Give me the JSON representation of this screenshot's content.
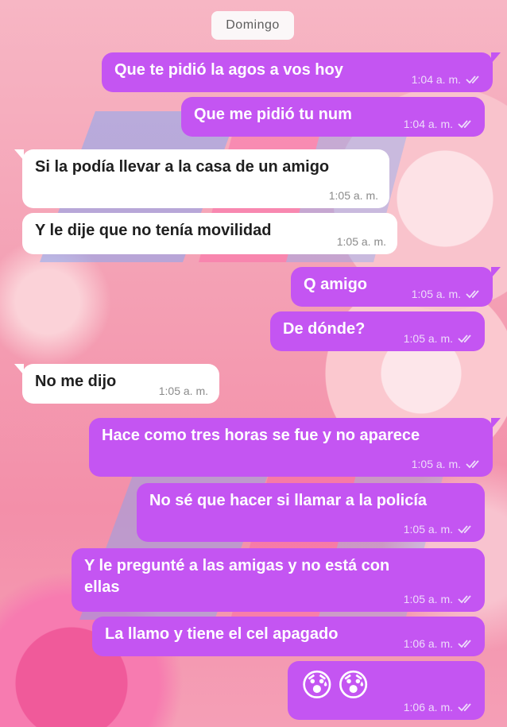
{
  "chat": {
    "day_label": "Domingo",
    "messages": [
      {
        "text": "Que te pidió la agos a vos hoy",
        "time": "1:04 a. m.",
        "direction": "out",
        "status": "read"
      },
      {
        "text": "Que me pidió tu num",
        "time": "1:04 a. m.",
        "direction": "out",
        "status": "read"
      },
      {
        "text": "Si la podía llevar a la casa de un amigo",
        "time": "1:05 a. m.",
        "direction": "in"
      },
      {
        "text": "Y le dije que no tenía movilidad",
        "time": "1:05 a. m.",
        "direction": "in"
      },
      {
        "text": "Q amigo",
        "time": "1:05 a. m.",
        "direction": "out",
        "status": "read"
      },
      {
        "text": "De dónde?",
        "time": "1:05 a. m.",
        "direction": "out",
        "status": "read"
      },
      {
        "text": "No me dijo",
        "time": "1:05 a. m.",
        "direction": "in"
      },
      {
        "text": "Hace como tres horas se fue y no aparece",
        "time": "1:05 a. m.",
        "direction": "out",
        "status": "read"
      },
      {
        "text": "No sé que hacer si llamar a la policía",
        "time": "1:05 a. m.",
        "direction": "out",
        "status": "read"
      },
      {
        "text": "Y le pregunté a las amigas y no está con ellas",
        "time": "1:05 a. m.",
        "direction": "out",
        "status": "read"
      },
      {
        "text": "La llamo y tiene el cel apagado",
        "time": "1:06 a. m.",
        "direction": "out",
        "status": "read"
      },
      {
        "text": "😰😰",
        "time": "1:06 a. m.",
        "direction": "out",
        "status": "read"
      }
    ]
  },
  "colors": {
    "outgoing_bubble": "#c455f2",
    "incoming_bubble": "#ffffff",
    "watermark_blue": "#6fa8ff",
    "watermark_pink": "#ff4fa0"
  },
  "icons": {
    "read_receipt": "double-check-icon"
  }
}
